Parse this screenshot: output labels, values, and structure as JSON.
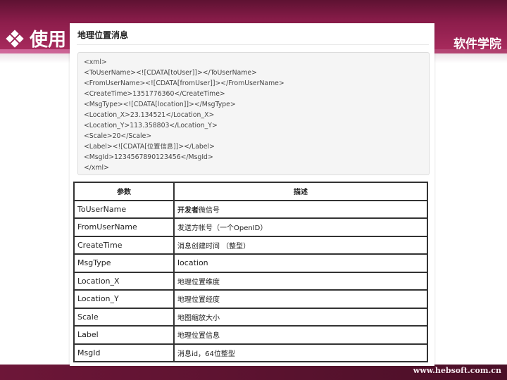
{
  "slide": {
    "title": "使用",
    "brand": "软件学院",
    "footer_url": "www.hebsoft.com.cn"
  },
  "panel": {
    "title": "地理位置消息",
    "code_lines": [
      "<xml>",
      "<ToUserName><![CDATA[toUser]]></ToUserName>",
      "<FromUserName><![CDATA[fromUser]]></FromUserName>",
      "<CreateTime>1351776360</CreateTime>",
      "<MsgType><![CDATA[location]]></MsgType>",
      "<Location_X>23.134521</Location_X>",
      "<Location_Y>113.358803</Location_Y>",
      "<Scale>20</Scale>",
      "<Label><![CDATA[位置信息]]></Label>",
      "<MsgId>1234567890123456</MsgId>",
      "</xml>"
    ]
  },
  "table": {
    "headers": [
      "参数",
      "描述"
    ],
    "rows": [
      {
        "param": "ToUserName",
        "desc_bold": "开发者",
        "desc": "微信号"
      },
      {
        "param": "FromUserName",
        "desc_bold": "",
        "desc": "发送方帐号（一个OpenID）"
      },
      {
        "param": "CreateTime",
        "desc_bold": "",
        "desc": "消息创建时间 （整型）"
      },
      {
        "param": "MsgType",
        "desc_bold": "",
        "desc": "location"
      },
      {
        "param": "Location_X",
        "desc_bold": "",
        "desc": "地理位置维度"
      },
      {
        "param": "Location_Y",
        "desc_bold": "",
        "desc": "地理位置经度"
      },
      {
        "param": "Scale",
        "desc_bold": "",
        "desc": "地图缩放大小"
      },
      {
        "param": "Label",
        "desc_bold": "",
        "desc": "地理位置信息"
      },
      {
        "param": "MsgId",
        "desc_bold": "",
        "desc": "消息id，64位整型"
      }
    ]
  }
}
